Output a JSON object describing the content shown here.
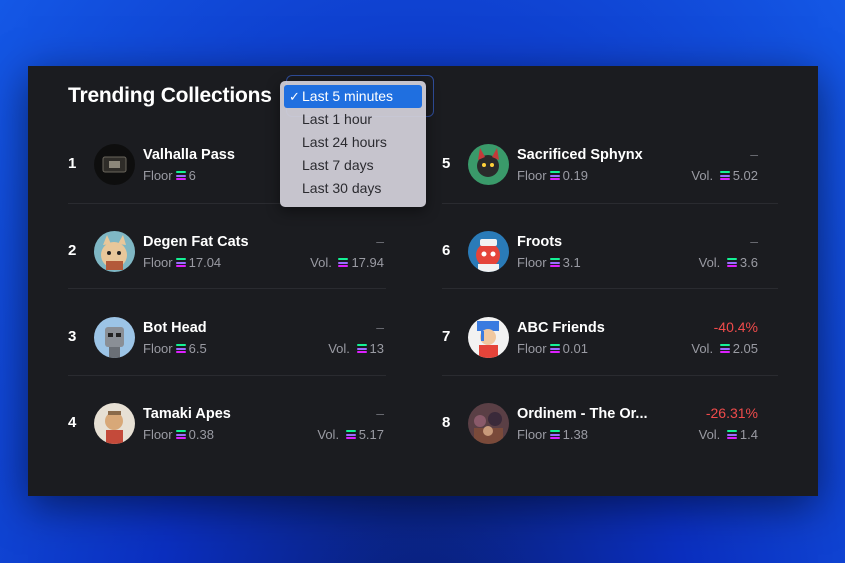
{
  "title": "Trending Collections",
  "time_filter": {
    "options": [
      "Last 5 minutes",
      "Last 1 hour",
      "Last 24 hours",
      "Last 7 days",
      "Last 30 days"
    ],
    "selected": "Last 5 minutes",
    "check": "✓"
  },
  "labels": {
    "floor": "Floor",
    "volume": "Vol."
  },
  "collections": [
    {
      "rank": "1",
      "name": "Valhalla Pass",
      "floor": "6",
      "change": "",
      "volume": "",
      "avatar_color": "#0e0e0e"
    },
    {
      "rank": "2",
      "name": "Degen Fat Cats",
      "floor": "17.04",
      "change": "–",
      "volume": "17.94",
      "avatar_color": "#7fb7c4"
    },
    {
      "rank": "3",
      "name": "Bot Head",
      "floor": "6.5",
      "change": "–",
      "volume": "13",
      "avatar_color": "#9cc4e6"
    },
    {
      "rank": "4",
      "name": "Tamaki Apes",
      "floor": "0.38",
      "change": "–",
      "volume": "5.17",
      "avatar_color": "#e7e0d4"
    },
    {
      "rank": "5",
      "name": "Sacrificed Sphynx",
      "floor": "0.19",
      "change": "–",
      "volume": "5.02",
      "avatar_color": "#3a9a6a"
    },
    {
      "rank": "6",
      "name": "Froots",
      "floor": "3.1",
      "change": "–",
      "volume": "3.6",
      "avatar_color": "#2a7bb8"
    },
    {
      "rank": "7",
      "name": "ABC Friends",
      "floor": "0.01",
      "change": "-40.4%",
      "volume": "2.05",
      "avatar_color": "#f2f2f2"
    },
    {
      "rank": "8",
      "name": "Ordinem - The Or...",
      "floor": "1.38",
      "change": "-26.31%",
      "volume": "1.4",
      "avatar_color": "#5a3f45"
    }
  ],
  "colors": {
    "negative": "#f04b4b",
    "neutral": "#6d6e75",
    "accent": "#1f6fe0"
  }
}
